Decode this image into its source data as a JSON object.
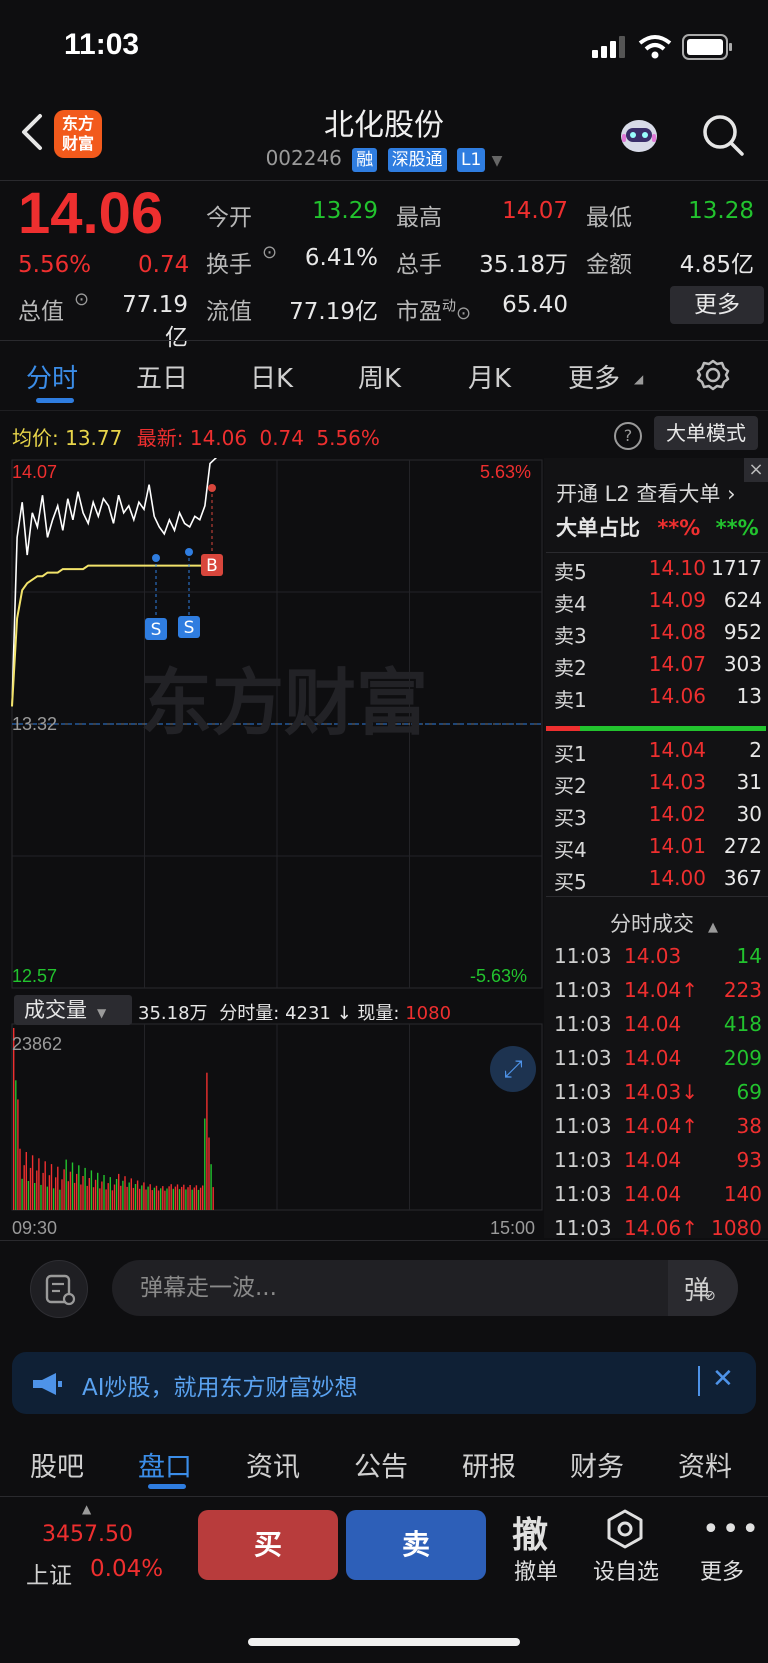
{
  "status": {
    "time": "11:03"
  },
  "header": {
    "logo_line1": "东方",
    "logo_line2": "财富",
    "stock_name": "北化股份",
    "stock_code": "002246",
    "tags": [
      "融",
      "深股通",
      "L1"
    ]
  },
  "quote": {
    "last_price": "14.06",
    "change_pct": "5.56%",
    "change_amt": "0.74",
    "open_label": "今开",
    "open_val": "13.29",
    "high_label": "最高",
    "high_val": "14.07",
    "low_label": "最低",
    "low_val": "13.28",
    "turnover_label": "换手",
    "turnover_val": "6.41%",
    "volume_label": "总手",
    "volume_val": "35.18万",
    "amount_label": "金额",
    "amount_val": "4.85亿",
    "mktcap_label": "总值",
    "mktcap_val": "77.19亿",
    "float_label": "流值",
    "float_val": "77.19亿",
    "pe_label": "市盈",
    "pe_sup": "动",
    "pe_val": "65.40",
    "more_label": "更多"
  },
  "ktabs": [
    "分时",
    "五日",
    "日K",
    "周K",
    "月K",
    "更多"
  ],
  "avgline": {
    "avg_label": "均价:",
    "avg_val": "13.77",
    "latest_label": "最新:",
    "latest_val": "14.06",
    "chg": "0.74",
    "pct": "5.56%",
    "big_order_label": "大单模式",
    "help": "?"
  },
  "chart": {
    "y_top": "14.07",
    "y_mid": "13.32",
    "y_bot": "12.57",
    "pct_top": "5.63%",
    "pct_bot": "-5.63%",
    "watermark": "东方财富",
    "vol_label": "成交量",
    "vol_total": "35.18万",
    "vol_seg_label": "分时量:",
    "vol_seg_val": "4231",
    "vol_now_label": "现量:",
    "vol_now_val": "1080",
    "vol_max": "23862",
    "t_start": "09:30",
    "t_end": "15:00",
    "marker_b": "B",
    "marker_s": "S"
  },
  "chart_data": {
    "type": "line",
    "title": "",
    "ylim": [
      12.57,
      14.07
    ],
    "series": [
      {
        "values": [
          13.37,
          13.85,
          13.95,
          13.8,
          13.92,
          13.88,
          13.97,
          13.85,
          13.9,
          13.94,
          13.87,
          13.96,
          13.9,
          13.98,
          13.92,
          13.89,
          13.95,
          13.91,
          13.96,
          13.94,
          13.89,
          13.97,
          13.92,
          13.94,
          13.9,
          13.95,
          13.93,
          14.0,
          13.91,
          13.88,
          13.86,
          13.9,
          13.87,
          13.92,
          13.89,
          13.88,
          13.91,
          13.9,
          13.94,
          14.06
        ]
      },
      {
        "name": "均价",
        "values": [
          13.37,
          13.62,
          13.7,
          13.72,
          13.73,
          13.74,
          13.74,
          13.75,
          13.75,
          13.75,
          13.76,
          13.76,
          13.76,
          13.76,
          13.76,
          13.77,
          13.77,
          13.77,
          13.77,
          13.77,
          13.77,
          13.77,
          13.77,
          13.77,
          13.77,
          13.77,
          13.77,
          13.77,
          13.77,
          13.77,
          13.77,
          13.77,
          13.77,
          13.77,
          13.77,
          13.77,
          13.77,
          13.77,
          13.77,
          13.77
        ]
      }
    ],
    "volume_max": 23862
  },
  "l2": {
    "promo": "开通 L2 查看大单 ›",
    "ratio_label": "大单占比",
    "ratio_red": "**%",
    "ratio_green": "**%"
  },
  "asks": [
    {
      "label": "卖5",
      "price": "14.10",
      "vol": "1717"
    },
    {
      "label": "卖4",
      "price": "14.09",
      "vol": "624"
    },
    {
      "label": "卖3",
      "price": "14.08",
      "vol": "952"
    },
    {
      "label": "卖2",
      "price": "14.07",
      "vol": "303"
    },
    {
      "label": "卖1",
      "price": "14.06",
      "vol": "13"
    }
  ],
  "bids": [
    {
      "label": "买1",
      "price": "14.04",
      "vol": "2"
    },
    {
      "label": "买2",
      "price": "14.03",
      "vol": "31"
    },
    {
      "label": "买3",
      "price": "14.02",
      "vol": "30"
    },
    {
      "label": "买4",
      "price": "14.01",
      "vol": "272"
    },
    {
      "label": "买5",
      "price": "14.00",
      "vol": "367"
    }
  ],
  "trades_title": "分时成交",
  "trades": [
    {
      "time": "11:03",
      "price": "14.03",
      "vol": "14",
      "color": "green"
    },
    {
      "time": "11:03",
      "price": "14.04↑",
      "vol": "223",
      "color": "red"
    },
    {
      "time": "11:03",
      "price": "14.04",
      "vol": "418",
      "color": "green"
    },
    {
      "time": "11:03",
      "price": "14.04",
      "vol": "209",
      "color": "green"
    },
    {
      "time": "11:03",
      "price": "14.03↓",
      "vol": "69",
      "color": "green"
    },
    {
      "time": "11:03",
      "price": "14.04↑",
      "vol": "38",
      "color": "red"
    },
    {
      "time": "11:03",
      "price": "14.04",
      "vol": "93",
      "color": "red"
    },
    {
      "time": "11:03",
      "price": "14.04",
      "vol": "140",
      "color": "red"
    },
    {
      "time": "11:03",
      "price": "14.06↑",
      "vol": "1080",
      "color": "red"
    }
  ],
  "comment": {
    "placeholder": "弹幕走一波...",
    "toggle_char": "弹"
  },
  "ai_banner": {
    "text": "AI炒股，就用东方财富妙想"
  },
  "bottom_tabs": [
    "股吧",
    "盘口",
    "资讯",
    "公告",
    "研报",
    "财务",
    "资料"
  ],
  "footer": {
    "index_val": "3457.50",
    "index_name": "上证",
    "index_pct": "0.04%",
    "buy": "买",
    "sell": "卖",
    "cancel_glyph": "撤",
    "cancel_label": "撤单",
    "watch_label": "设自选",
    "more_label": "更多"
  }
}
